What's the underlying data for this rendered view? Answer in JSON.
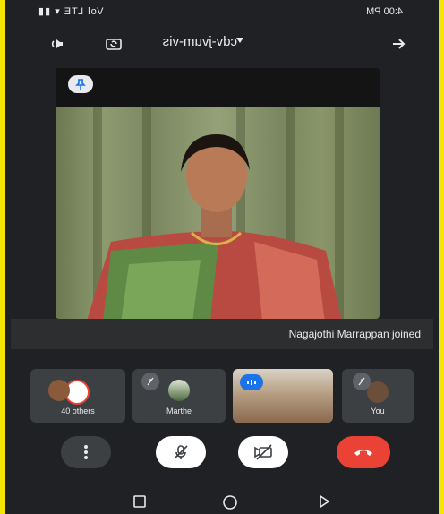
{
  "status": {
    "time": "4:00 PM",
    "signal": "Vol LTE ▾ ▮▮"
  },
  "header": {
    "meeting_code": "cdv-jvum-vis"
  },
  "main": {
    "banner": "Nagajothi Marrappan joined"
  },
  "participants": [
    {
      "name": "You"
    },
    {
      "name": ""
    },
    {
      "name": "Marthe"
    },
    {
      "name": "40 others"
    }
  ],
  "colors": {
    "background": "#202124",
    "tile": "#3c4043",
    "end_call": "#ea4335",
    "accent": "#1a73e8",
    "frame": "#f5e600"
  },
  "icons": [
    "back-arrow-icon",
    "caret-icon",
    "switch-camera-icon",
    "speaker-icon",
    "pin-icon",
    "mic-off-icon",
    "video-off-icon",
    "end-call-icon",
    "more-options-icon",
    "nav-back-icon",
    "nav-home-icon",
    "nav-recents-icon"
  ]
}
